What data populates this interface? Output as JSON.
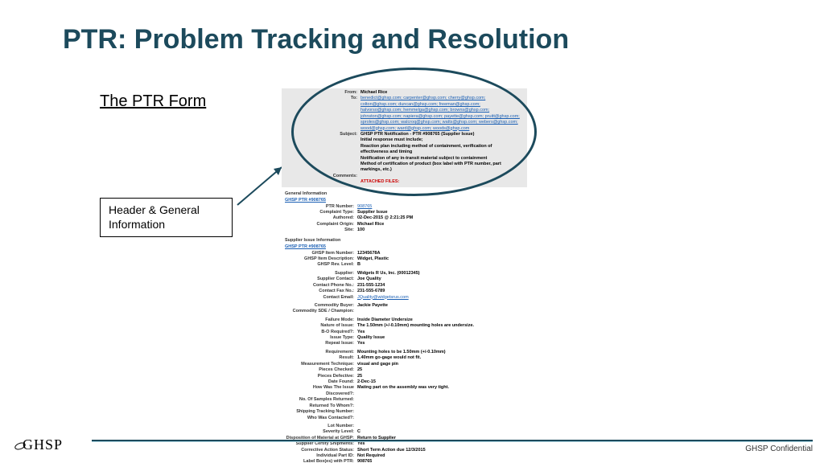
{
  "title": "PTR: Problem Tracking and Resolution",
  "subtitle": "The PTR Form",
  "annotation": "Header & General Information",
  "footer": {
    "logo": "GHSP",
    "confidential": "GHSP Confidential"
  },
  "email": {
    "from_label": "From:",
    "from": "Michael Rice",
    "to_label": "To:",
    "to": "benedict@ghsp.com; carpenter@ghsp.com; cherry@ghsp.com; colton@ghsp.com; duncan@ghsp.com; freeman@ghsp.com; halvorso@ghsp.com; hemmelga@ghsp.com; browns@ghsp.com; johnston@ghsp.com; napiera@ghsp.com; payette@ghsp.com; pruitt@ghsp.com; sproles@ghsp.com; walcroq@ghsp.com; watts@ghsp.com; webers@ghsp.com; wood@ghsp.com; ward@ghsp.com; woods@ghsp.com",
    "subject_label": "Subject:",
    "subject": "GHSP PTR Notification - PTR #908765 (Supplier Issue)",
    "body_label": "",
    "body1": "Initial response must include;",
    "body2": "Reaction plan including method of containment, verification of effectiveness and timing",
    "body3": "Notification of any in-transit material subject to containment",
    "body4": "Method of certification of product (box label with PTR number, part markings, etc.)",
    "comments_label": "Comments:",
    "attached": "ATTACHED FILES:"
  },
  "general": {
    "heading": "General Information",
    "ptrlink": "GHSP PTR #908765",
    "ptr_num_label": "PTR Number:",
    "ptr_num": "908765",
    "complaint_label": "Complaint Type:",
    "complaint": "Supplier Issue",
    "authored_label": "Authored:",
    "authored": "02-Dec-2015 @ 2:21:25 PM",
    "origin_label": "Complaint Origin:",
    "origin": "Michael Rice",
    "site_label": "Site:",
    "site": "100"
  },
  "supplier": {
    "heading": "Supplier Issue Information",
    "ptrlink": "GHSP PTR #908765",
    "item_label": "GHSP Item Number:",
    "item": "12345678A",
    "desc_label": "GHSP Item Description:",
    "desc": "Widget, Plastic",
    "level_label": "GHSP Rev. Level:",
    "level": "B",
    "sup_label": "Supplier:",
    "sup": "Widgets R Us, Inc. (00012345)",
    "contact_label": "Supplier Contact:",
    "contact": "Joe Quality",
    "phone_label": "Contact Phone No.:",
    "phone": "231-555-1234",
    "fax_label": "Contact Fax No.:",
    "fax": "231-555-6789",
    "email_label": "Contact Email:",
    "email": "JQuality@widgetsrus.com",
    "buyer_label": "Commodity Buyer:",
    "buyer": "Jackie Payette",
    "champ_label": "Commodity SDE / Champion:",
    "champ": "",
    "fail_label": "Failure Mode:",
    "fail": "Inside Diameter Undersize",
    "nature_label": "Nature of Issue:",
    "nature": "The 1.50mm (+/-0.10mm) mounting holes are undersize.",
    "bo_label": "B-O Required?:",
    "bo": "Yes",
    "itype_label": "Issue Type:",
    "itype": "Quality Issue",
    "repeat_label": "Repeat Issue:",
    "repeat": "Yes",
    "req_label": "Requirement:",
    "req": "Mounting holes to be 1.50mm (+/-0.10mm)",
    "result_label": "Result:",
    "result": "1.40mm go-gage would not fit.",
    "meas_label": "Measurement Technique:",
    "meas": "visual and gage pin",
    "checked_label": "Pieces Checked:",
    "checked": "25",
    "defect_label": "Pieces Defective:",
    "defect": "25",
    "date_label": "Date Found:",
    "date": "2-Dec-15",
    "disc_label": "How Was The Issue Discovered?:",
    "disc": "Mating part on the assembly was very tight.",
    "samples_label": "No. Of Samples Returned:",
    "samples": "",
    "returned_label": "Returned To Whom?:",
    "returned": "",
    "ship_label": "Shipping Tracking Number:",
    "ship": "",
    "who_label": "Who Was Contacted?:",
    "who": "",
    "lot_label": "Lot Number:",
    "lot": "",
    "sev_label": "Severity Level:",
    "sev": "C",
    "disp_label": "Disposition of Material at GHSP:",
    "disp": "Return to Supplier",
    "cert_label": "Supplier Certify Shipments:",
    "cert": "Yes",
    "cas_label": "Corrective Action Status:",
    "cas": "Short Term Action due 12/3/2015",
    "indpart_label": "Individual Part ID:",
    "indpart": "Not Required",
    "boxlabel_label": "Label Box(es) with PTR:",
    "boxlabel": "908765"
  }
}
